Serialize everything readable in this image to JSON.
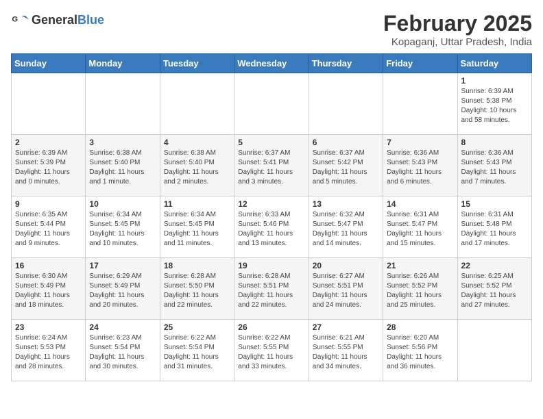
{
  "header": {
    "logo_general": "General",
    "logo_blue": "Blue",
    "main_title": "February 2025",
    "subtitle": "Kopaganj, Uttar Pradesh, India"
  },
  "weekdays": [
    "Sunday",
    "Monday",
    "Tuesday",
    "Wednesday",
    "Thursday",
    "Friday",
    "Saturday"
  ],
  "weeks": [
    [
      {
        "day": "",
        "info": ""
      },
      {
        "day": "",
        "info": ""
      },
      {
        "day": "",
        "info": ""
      },
      {
        "day": "",
        "info": ""
      },
      {
        "day": "",
        "info": ""
      },
      {
        "day": "",
        "info": ""
      },
      {
        "day": "1",
        "info": "Sunrise: 6:39 AM\nSunset: 5:38 PM\nDaylight: 10 hours\nand 58 minutes."
      }
    ],
    [
      {
        "day": "2",
        "info": "Sunrise: 6:39 AM\nSunset: 5:39 PM\nDaylight: 11 hours\nand 0 minutes."
      },
      {
        "day": "3",
        "info": "Sunrise: 6:38 AM\nSunset: 5:40 PM\nDaylight: 11 hours\nand 1 minute."
      },
      {
        "day": "4",
        "info": "Sunrise: 6:38 AM\nSunset: 5:40 PM\nDaylight: 11 hours\nand 2 minutes."
      },
      {
        "day": "5",
        "info": "Sunrise: 6:37 AM\nSunset: 5:41 PM\nDaylight: 11 hours\nand 3 minutes."
      },
      {
        "day": "6",
        "info": "Sunrise: 6:37 AM\nSunset: 5:42 PM\nDaylight: 11 hours\nand 5 minutes."
      },
      {
        "day": "7",
        "info": "Sunrise: 6:36 AM\nSunset: 5:43 PM\nDaylight: 11 hours\nand 6 minutes."
      },
      {
        "day": "8",
        "info": "Sunrise: 6:36 AM\nSunset: 5:43 PM\nDaylight: 11 hours\nand 7 minutes."
      }
    ],
    [
      {
        "day": "9",
        "info": "Sunrise: 6:35 AM\nSunset: 5:44 PM\nDaylight: 11 hours\nand 9 minutes."
      },
      {
        "day": "10",
        "info": "Sunrise: 6:34 AM\nSunset: 5:45 PM\nDaylight: 11 hours\nand 10 minutes."
      },
      {
        "day": "11",
        "info": "Sunrise: 6:34 AM\nSunset: 5:45 PM\nDaylight: 11 hours\nand 11 minutes."
      },
      {
        "day": "12",
        "info": "Sunrise: 6:33 AM\nSunset: 5:46 PM\nDaylight: 11 hours\nand 13 minutes."
      },
      {
        "day": "13",
        "info": "Sunrise: 6:32 AM\nSunset: 5:47 PM\nDaylight: 11 hours\nand 14 minutes."
      },
      {
        "day": "14",
        "info": "Sunrise: 6:31 AM\nSunset: 5:47 PM\nDaylight: 11 hours\nand 15 minutes."
      },
      {
        "day": "15",
        "info": "Sunrise: 6:31 AM\nSunset: 5:48 PM\nDaylight: 11 hours\nand 17 minutes."
      }
    ],
    [
      {
        "day": "16",
        "info": "Sunrise: 6:30 AM\nSunset: 5:49 PM\nDaylight: 11 hours\nand 18 minutes."
      },
      {
        "day": "17",
        "info": "Sunrise: 6:29 AM\nSunset: 5:49 PM\nDaylight: 11 hours\nand 20 minutes."
      },
      {
        "day": "18",
        "info": "Sunrise: 6:28 AM\nSunset: 5:50 PM\nDaylight: 11 hours\nand 22 minutes."
      },
      {
        "day": "19",
        "info": "Sunrise: 6:28 AM\nSunset: 5:51 PM\nDaylight: 11 hours\nand 22 minutes."
      },
      {
        "day": "20",
        "info": "Sunrise: 6:27 AM\nSunset: 5:51 PM\nDaylight: 11 hours\nand 24 minutes."
      },
      {
        "day": "21",
        "info": "Sunrise: 6:26 AM\nSunset: 5:52 PM\nDaylight: 11 hours\nand 25 minutes."
      },
      {
        "day": "22",
        "info": "Sunrise: 6:25 AM\nSunset: 5:52 PM\nDaylight: 11 hours\nand 27 minutes."
      }
    ],
    [
      {
        "day": "23",
        "info": "Sunrise: 6:24 AM\nSunset: 5:53 PM\nDaylight: 11 hours\nand 28 minutes."
      },
      {
        "day": "24",
        "info": "Sunrise: 6:23 AM\nSunset: 5:54 PM\nDaylight: 11 hours\nand 30 minutes."
      },
      {
        "day": "25",
        "info": "Sunrise: 6:22 AM\nSunset: 5:54 PM\nDaylight: 11 hours\nand 31 minutes."
      },
      {
        "day": "26",
        "info": "Sunrise: 6:22 AM\nSunset: 5:55 PM\nDaylight: 11 hours\nand 33 minutes."
      },
      {
        "day": "27",
        "info": "Sunrise: 6:21 AM\nSunset: 5:55 PM\nDaylight: 11 hours\nand 34 minutes."
      },
      {
        "day": "28",
        "info": "Sunrise: 6:20 AM\nSunset: 5:56 PM\nDaylight: 11 hours\nand 36 minutes."
      },
      {
        "day": "",
        "info": ""
      }
    ]
  ]
}
